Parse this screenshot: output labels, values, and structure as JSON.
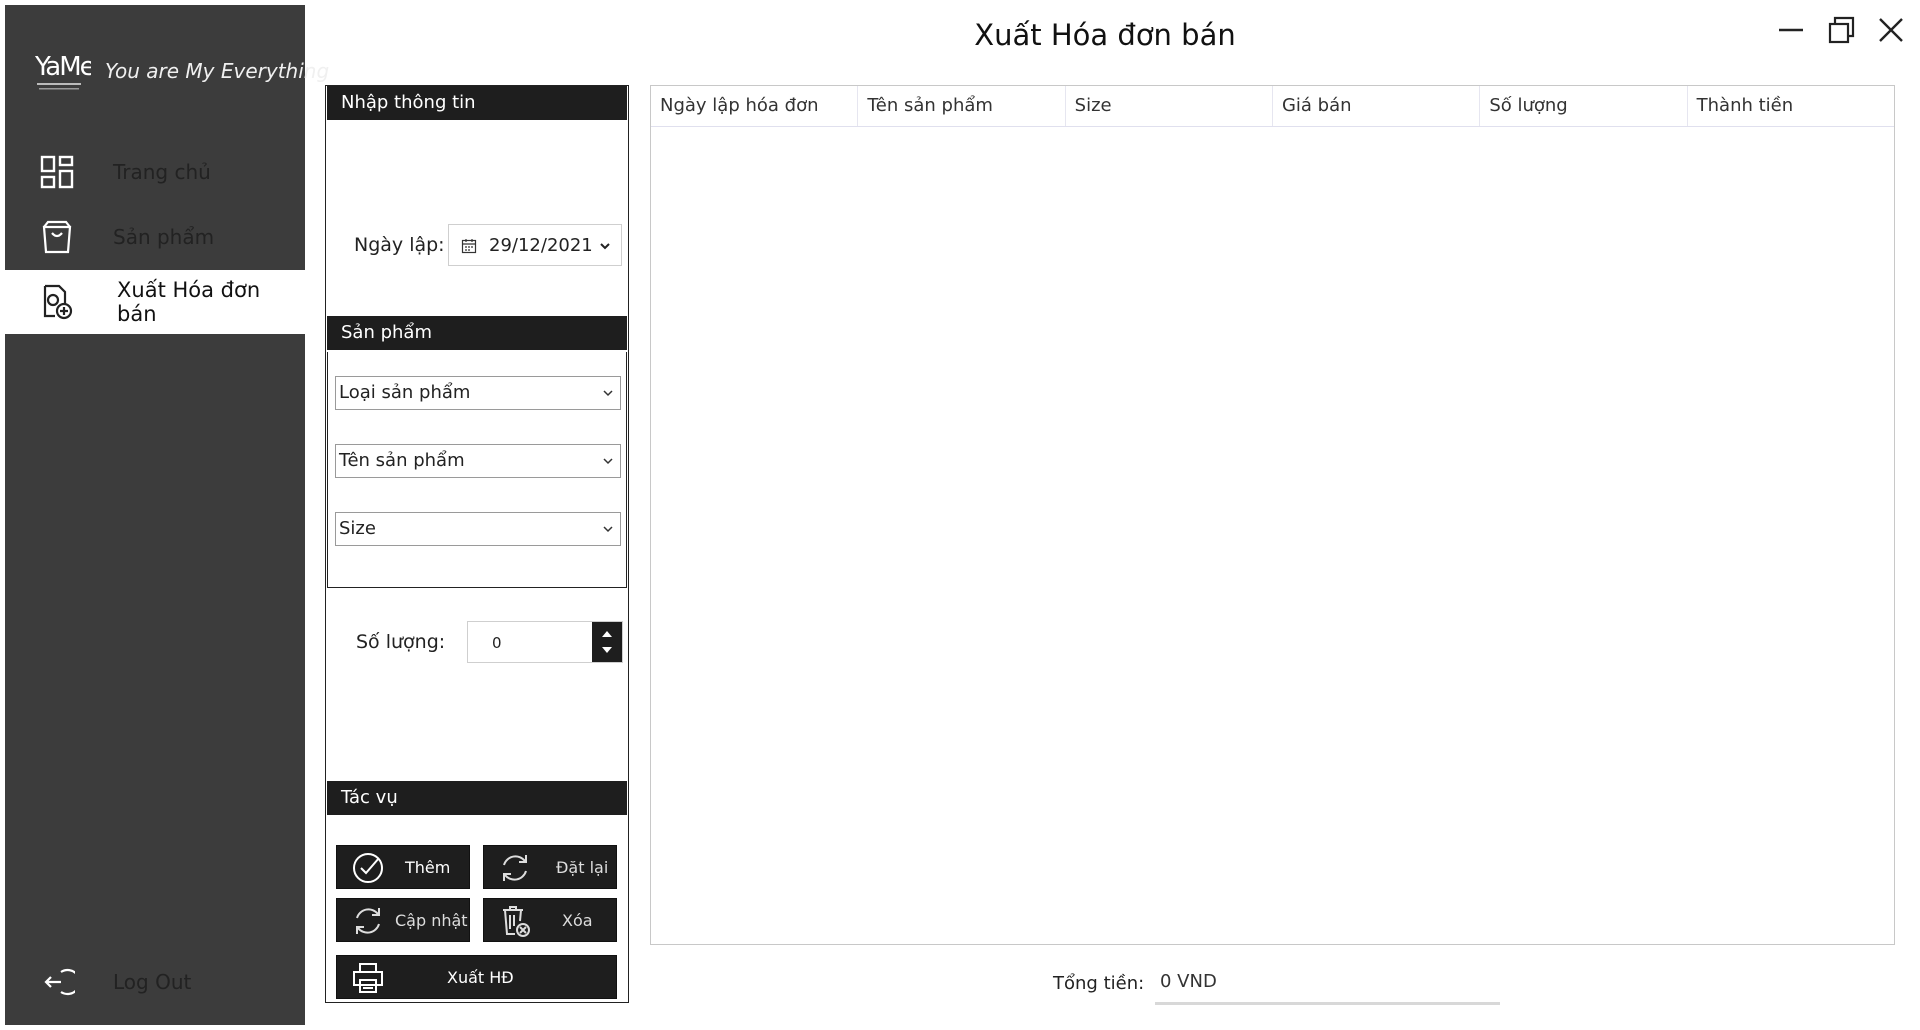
{
  "window": {
    "title": "Xuất Hóa đơn bán"
  },
  "brand": {
    "tagline": "You are My Everything"
  },
  "nav": {
    "items": [
      {
        "label": "Trang chủ",
        "icon": "dashboard-icon"
      },
      {
        "label": "Sản phẩm",
        "icon": "box-icon"
      },
      {
        "label": "Xuất Hóa đơn bán",
        "icon": "invoice-add-icon",
        "active": true
      }
    ],
    "logout": {
      "label": "Log Out",
      "icon": "logout-icon"
    }
  },
  "form": {
    "section_info": "Nhập thông tin",
    "date_label": "Ngày lập:",
    "date_value": "29/12/2021",
    "section_product": "Sản phẩm",
    "category_value": "Loại sản phẩm",
    "product_value": "Tên sản phẩm",
    "size_value": "Size",
    "quantity_label": "Số lượng:",
    "quantity_value": "0",
    "section_actions": "Tác vụ",
    "buttons": {
      "add": "Thêm",
      "reset": "Đặt lại",
      "update": "Cập nhật",
      "delete": "Xóa",
      "export": "Xuất HĐ"
    }
  },
  "table": {
    "columns": [
      "Ngày lập hóa đơn",
      "Tên sản phẩm",
      "Size",
      "Giá bán",
      "Số lượng",
      "Thành tiền"
    ],
    "rows": []
  },
  "total": {
    "label": "Tổng tiền:",
    "value": "0 VND"
  },
  "colors": {
    "sidebar": "#3c3c3c",
    "dark": "#1e1e1e",
    "background": "#ffffff"
  }
}
